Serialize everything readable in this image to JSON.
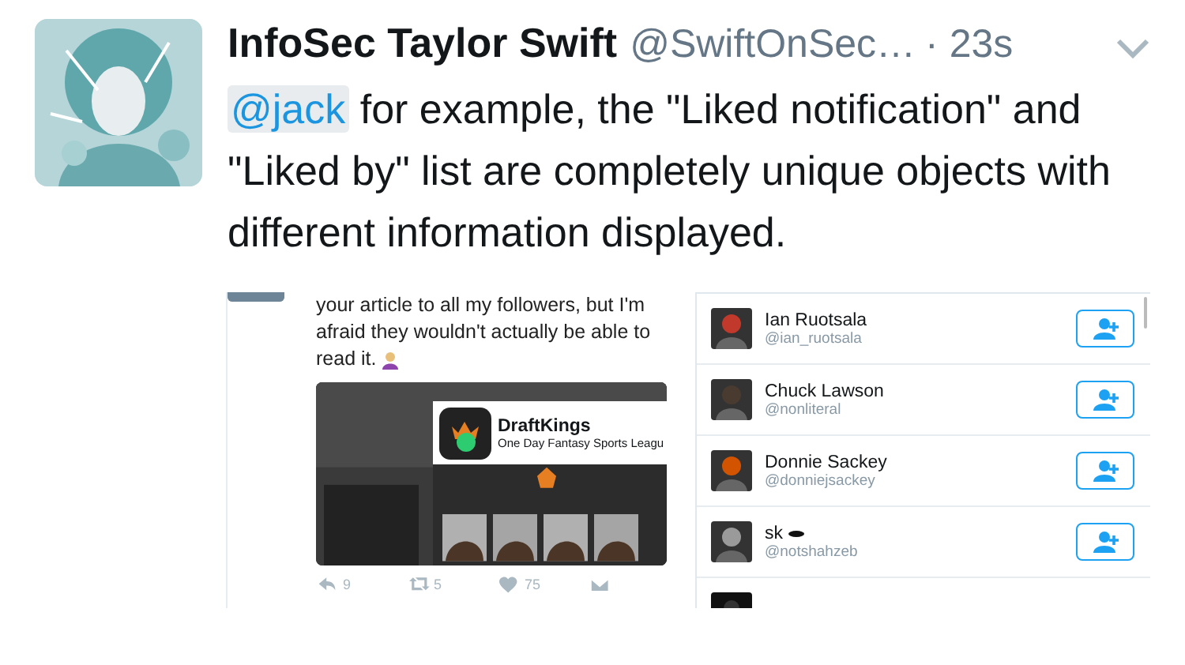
{
  "tweet": {
    "author_name": "InfoSec Taylor Swift",
    "handle": "@SwiftOnSec…",
    "time": "· 23s",
    "mention": "@jack",
    "text": " for example, the \"Liked notification\" and \"Liked by\" list are completely unique objects with different information displayed."
  },
  "embedded_left": {
    "text_lines": [
      "your article to all my followers, but I'm",
      "afraid they wouldn't actually be able to",
      "read it."
    ],
    "ad": {
      "title": "DraftKings",
      "subtitle": "One Day Fantasy Sports Leagu"
    },
    "actions": [
      {
        "kind": "reply",
        "count": "9"
      },
      {
        "kind": "retweet",
        "count": "5"
      },
      {
        "kind": "like",
        "count": "75"
      },
      {
        "kind": "message"
      }
    ]
  },
  "embedded_right": {
    "users": [
      {
        "name": "Ian Ruotsala",
        "handle": "@ian_ruotsala"
      },
      {
        "name": "Chuck Lawson",
        "handle": "@nonliteral"
      },
      {
        "name": "Donnie  Sackey",
        "handle": "@donniejsackey"
      },
      {
        "name": "sk",
        "handle": "@notshahzeb"
      }
    ]
  }
}
